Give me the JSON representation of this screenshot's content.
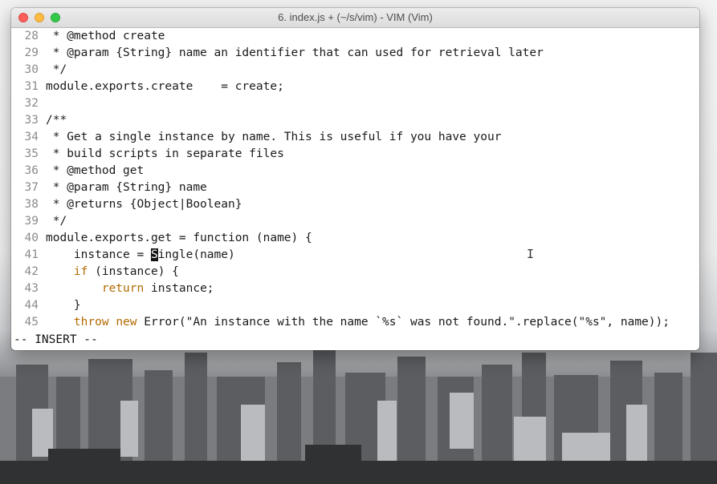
{
  "window": {
    "title": "6. index.js + (~/s/vim) - VIM (Vim)"
  },
  "editor": {
    "lines": [
      {
        "num": "28",
        "segments": [
          {
            "t": " * @method create"
          }
        ]
      },
      {
        "num": "29",
        "segments": [
          {
            "t": " * @param {String} name an identifier that can used for retrieval later"
          }
        ]
      },
      {
        "num": "30",
        "segments": [
          {
            "t": " */"
          }
        ]
      },
      {
        "num": "31",
        "segments": [
          {
            "t": "module.exports.create    = create;"
          }
        ]
      },
      {
        "num": "32",
        "segments": [
          {
            "t": ""
          }
        ]
      },
      {
        "num": "33",
        "segments": [
          {
            "t": "/**"
          }
        ]
      },
      {
        "num": "34",
        "segments": [
          {
            "t": " * Get a single instance by name. This is useful if you have your"
          }
        ]
      },
      {
        "num": "35",
        "segments": [
          {
            "t": " * build scripts in separate files"
          }
        ]
      },
      {
        "num": "36",
        "segments": [
          {
            "t": " * @method get"
          }
        ]
      },
      {
        "num": "37",
        "segments": [
          {
            "t": " * @param {String} name"
          }
        ]
      },
      {
        "num": "38",
        "segments": [
          {
            "t": " * @returns {Object|Boolean}"
          }
        ]
      },
      {
        "num": "39",
        "segments": [
          {
            "t": " */"
          }
        ]
      },
      {
        "num": "40",
        "segments": [
          {
            "t": "module.exports.get = function (name) {"
          }
        ]
      },
      {
        "num": "41",
        "segments": [
          {
            "t": "    instance = "
          },
          {
            "t": "S",
            "c": "cursor"
          },
          {
            "t": "ingle(name)"
          }
        ]
      },
      {
        "num": "42",
        "segments": [
          {
            "t": "    "
          },
          {
            "t": "if",
            "c": "kw"
          },
          {
            "t": " (instance) {"
          }
        ]
      },
      {
        "num": "43",
        "segments": [
          {
            "t": "        "
          },
          {
            "t": "return",
            "c": "kw"
          },
          {
            "t": " instance;"
          }
        ]
      },
      {
        "num": "44",
        "segments": [
          {
            "t": "    }"
          }
        ]
      },
      {
        "num": "45",
        "segments": [
          {
            "t": "    "
          },
          {
            "t": "throw",
            "c": "kw"
          },
          {
            "t": " "
          },
          {
            "t": "new",
            "c": "kw"
          },
          {
            "t": " Error(\"An instance with the name `%s` was not found.\".replace(\"%s\", name));"
          }
        ]
      }
    ],
    "mode_text": "-- INSERT --",
    "cursor_char": "S"
  },
  "icons": {
    "close": "close-button-icon",
    "minimize": "minimize-button-icon",
    "maximize": "maximize-button-icon",
    "text_cursor": "ibeam-cursor-icon"
  },
  "colors": {
    "keyword": "#b26a00",
    "line_number": "#8b8b8b",
    "close": "#fc605c",
    "minimize": "#fdbc40",
    "maximize": "#34c84a"
  }
}
